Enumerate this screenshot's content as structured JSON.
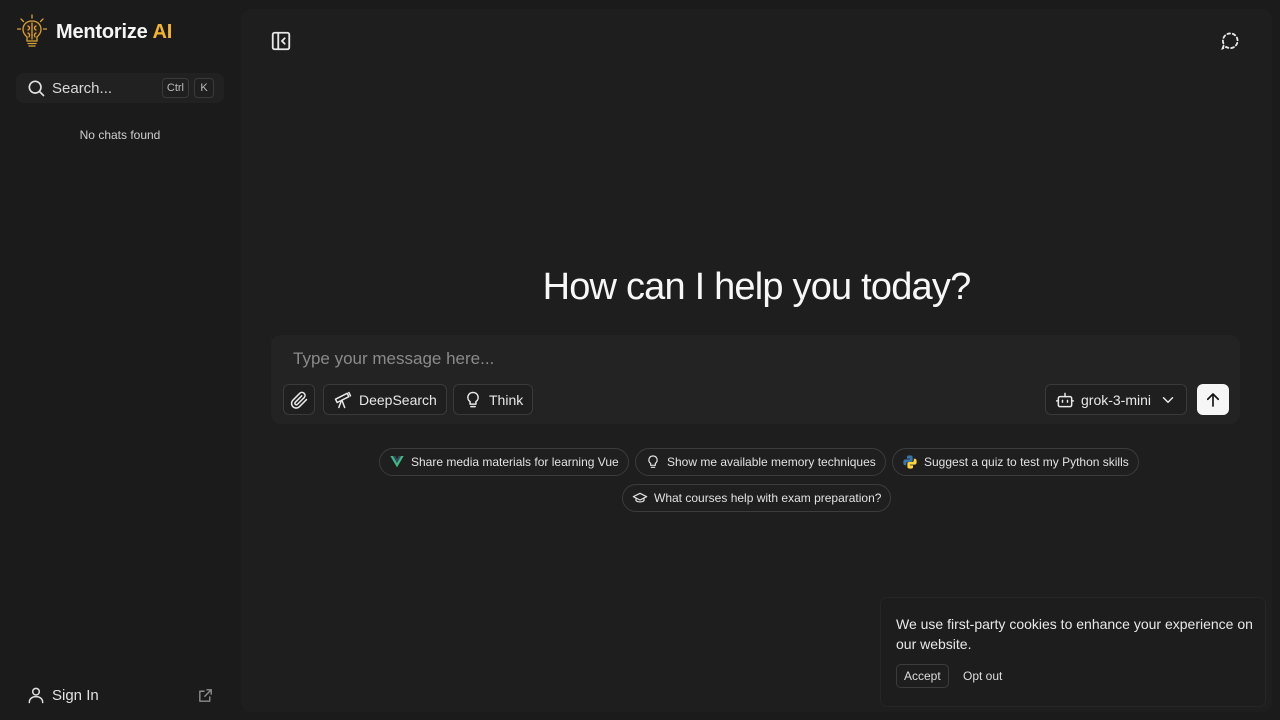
{
  "brand": {
    "name": "Mentorize",
    "accent": "AI",
    "accent_color": "#f2b52c",
    "logo_icon": "lightbulb-brain-icon"
  },
  "sidebar": {
    "search": {
      "label": "Search...",
      "shortcut_modifier": "Ctrl",
      "shortcut_key": "K",
      "icon": "search-icon"
    },
    "empty_state": "No chats found",
    "footer": {
      "signin_label": "Sign In",
      "user_icon": "user-icon",
      "external_icon": "external-link-icon"
    }
  },
  "header": {
    "toggle_icon": "sidebar-toggle-icon",
    "new_chat_icon": "new-chat-icon"
  },
  "main": {
    "headline": "How can I help you today?",
    "composer": {
      "placeholder": "Type your message here...",
      "attach_icon": "paperclip-icon",
      "deepsearch_label": "DeepSearch",
      "think_label": "Think",
      "model_label": "grok-3-mini",
      "send_icon": "arrow-up-icon"
    },
    "suggestions": [
      {
        "label": "Share media materials for learning Vue",
        "icon": "vue-icon"
      },
      {
        "label": "Show me available memory techniques",
        "icon": "lightbulb-icon"
      },
      {
        "label": "Suggest a quiz to test my Python skills",
        "icon": "python-icon"
      },
      {
        "label": "What courses help with exam preparation?",
        "icon": "graduation-cap-icon"
      }
    ]
  },
  "cookie_banner": {
    "text": "We use first-party cookies to enhance your experience on our website.",
    "accept_label": "Accept",
    "optout_label": "Opt out"
  },
  "colors": {
    "background": "#1b1b1b",
    "panel": "#1e1e1e",
    "composer": "#232323",
    "send_button": "#f6f6f6"
  }
}
